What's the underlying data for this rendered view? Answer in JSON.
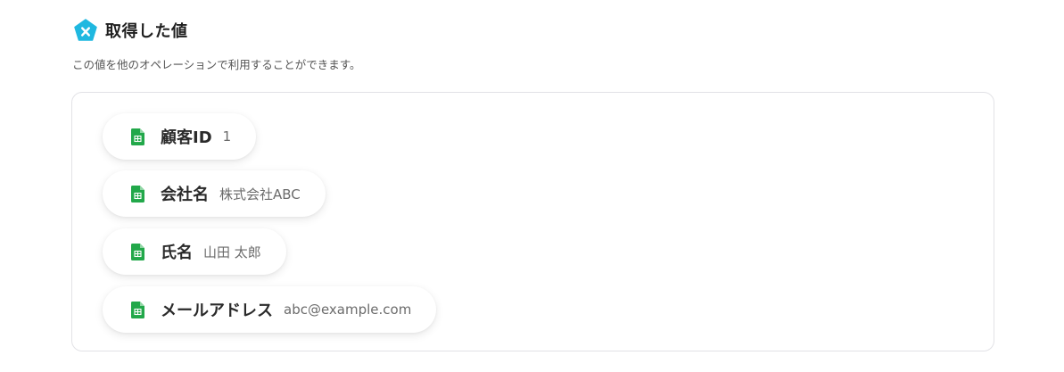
{
  "header": {
    "icon": "x-pentagon-icon",
    "title": "取得した値",
    "subtitle": "この値を他のオペレーションで利用することができます。"
  },
  "colors": {
    "accent": "#1fb8e0",
    "sheet_green": "#22a84a"
  },
  "fields": [
    {
      "icon": "spreadsheet-icon",
      "label": "顧客ID",
      "value": "1"
    },
    {
      "icon": "spreadsheet-icon",
      "label": "会社名",
      "value": "株式会社ABC"
    },
    {
      "icon": "spreadsheet-icon",
      "label": "氏名",
      "value": "山田 太郎"
    },
    {
      "icon": "spreadsheet-icon",
      "label": "メールアドレス",
      "value": "abc@example.com"
    }
  ]
}
